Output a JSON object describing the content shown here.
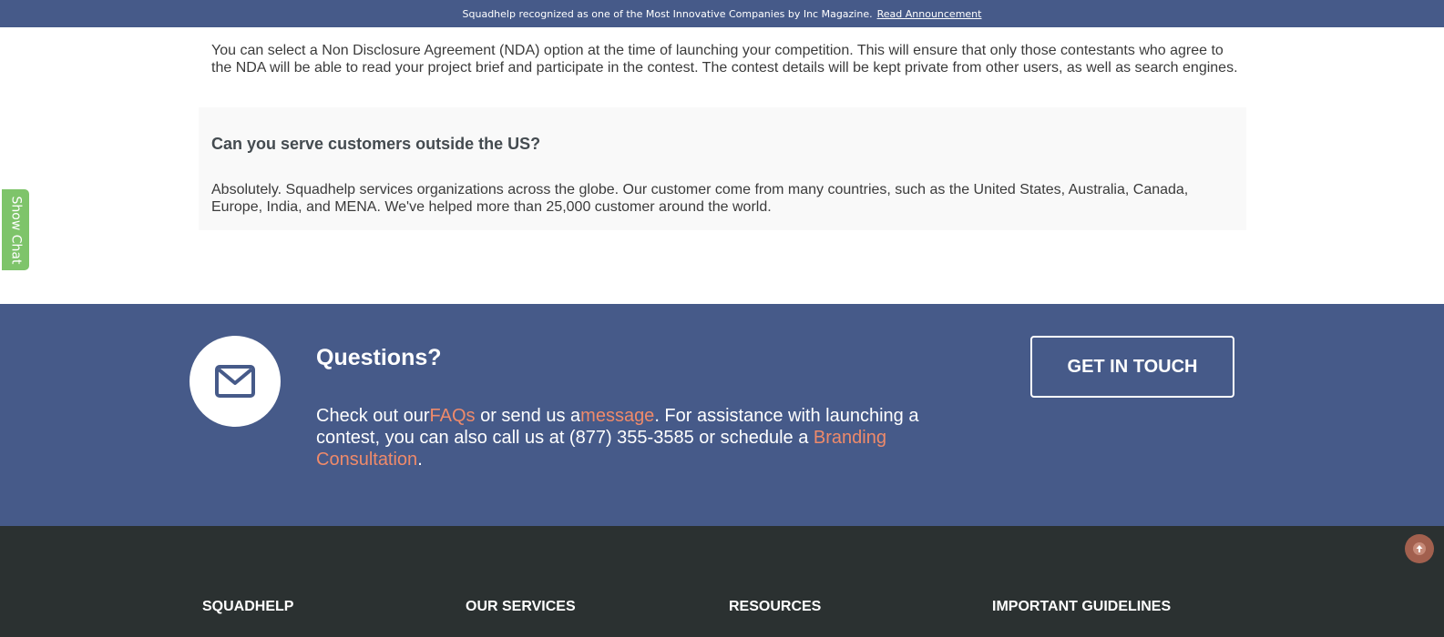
{
  "banner": {
    "text": "Squadhelp recognized as one of the Most Innovative Companies by Inc Magazine.",
    "link": "Read Announcement"
  },
  "faq": {
    "prev_answer": "You can select a Non Disclosure Agreement (NDA) option at the time of launching your competition. This will ensure that only those contestants who agree to the NDA will be able to read your project brief and participate in the contest. The contest details will be kept private from other users, as well as search engines.",
    "question": "Can you serve customers outside the US?",
    "answer": "Absolutely. Squadhelp services organizations across the globe. Our customer come from many countries, such as the United States, Australia, Canada, Europe, India, and MENA. We've helped more than 25,000 customer around the world."
  },
  "chat": {
    "label": "Show Chat"
  },
  "questions": {
    "title": "Questions?",
    "text_1": "Check out our",
    "link_faqs": "FAQs",
    "text_2": " or send us a",
    "link_message": "message",
    "text_3": ". For assistance with launching a contest, you can also call us at (877) 355-3585 or schedule a ",
    "link_branding": "Branding Consultation",
    "text_4": ".",
    "button": "GET IN TOUCH",
    "icon": "mail-icon"
  },
  "footer": {
    "headings": [
      "SQUADHELP",
      "OUR SERVICES",
      "RESOURCES",
      "IMPORTANT GUIDELINES"
    ]
  },
  "colors": {
    "brand_blue": "#465a89",
    "accent_orange": "#ef8a6a",
    "chat_green": "#7ec46a",
    "footer_dark": "#2b3131"
  }
}
